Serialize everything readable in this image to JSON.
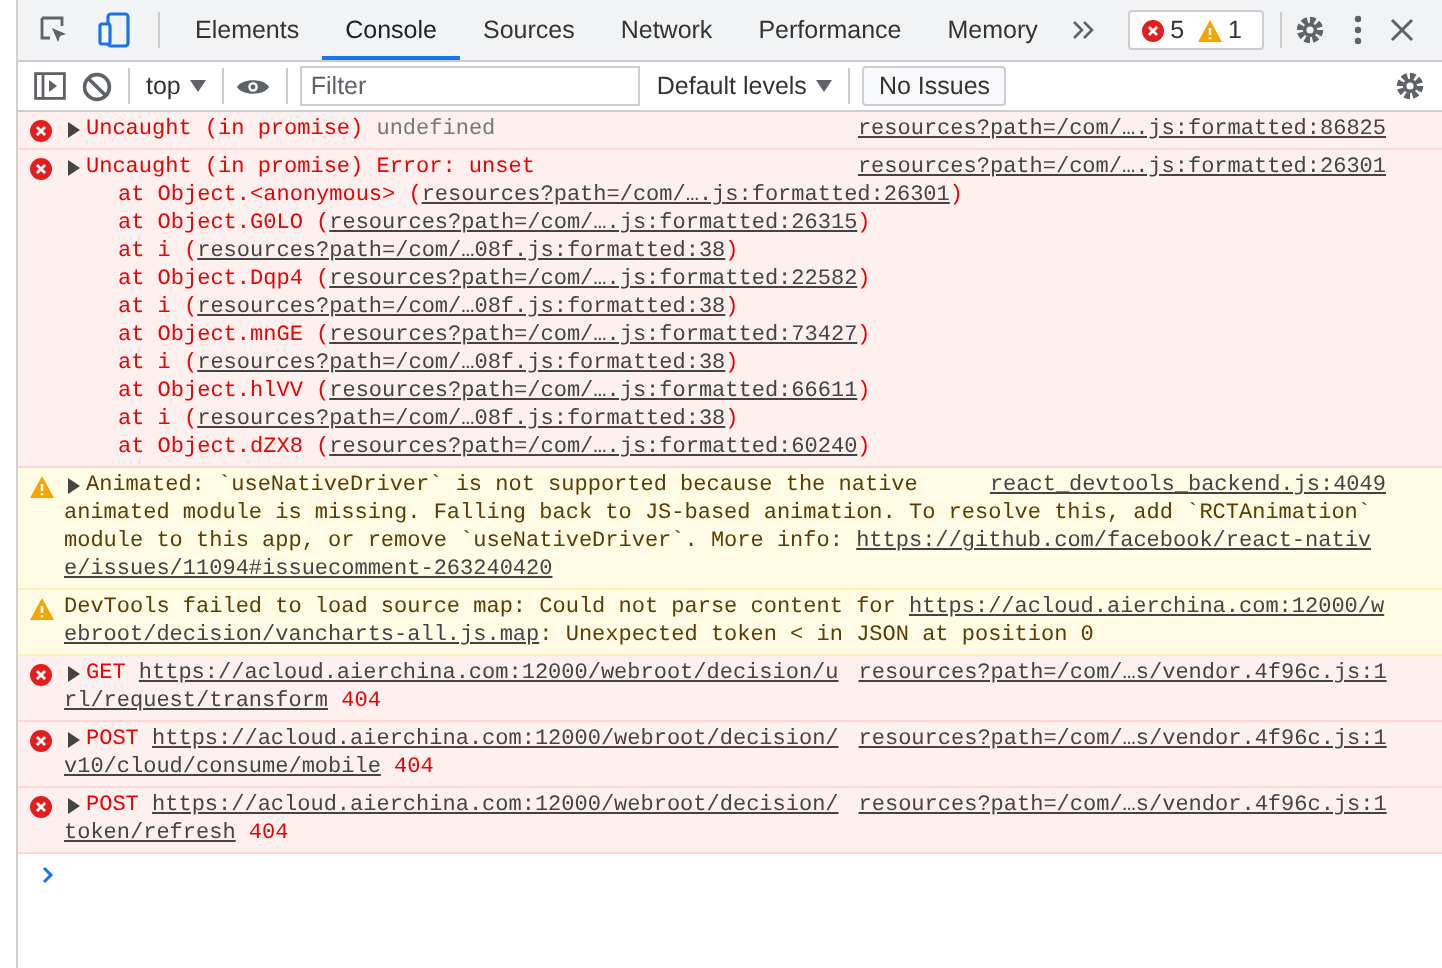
{
  "tabs": [
    {
      "label": "Elements",
      "selected": false
    },
    {
      "label": "Console",
      "selected": true
    },
    {
      "label": "Sources",
      "selected": false
    },
    {
      "label": "Network",
      "selected": false
    },
    {
      "label": "Performance",
      "selected": false
    },
    {
      "label": "Memory",
      "selected": false
    }
  ],
  "counts": {
    "errors": "5",
    "warnings": "1"
  },
  "toolbar": {
    "context": "top",
    "filter_placeholder": "Filter",
    "levels": "Default levels",
    "issues": "No Issues"
  },
  "messages": [
    {
      "kind": "error",
      "expandable": true,
      "source": "resources?path=/com/….js:formatted:86825",
      "lines": [
        [
          {
            "kind": "text",
            "text": "Uncaught (in promise) "
          },
          {
            "kind": "muted",
            "text": "undefined"
          }
        ]
      ]
    },
    {
      "kind": "error",
      "expandable": true,
      "source": "resources?path=/com/….js:formatted:26301",
      "lines": [
        [
          {
            "kind": "text",
            "text": "Uncaught (in promise) Error: unset"
          }
        ]
      ],
      "stack": [
        [
          {
            "kind": "text",
            "text": "at Object.<anonymous> ("
          },
          {
            "kind": "link",
            "text": "resources?path=/com/….js:formatted:26301"
          },
          {
            "kind": "text",
            "text": ")"
          }
        ],
        [
          {
            "kind": "text",
            "text": "at Object.G0LO ("
          },
          {
            "kind": "link",
            "text": "resources?path=/com/….js:formatted:26315"
          },
          {
            "kind": "text",
            "text": ")"
          }
        ],
        [
          {
            "kind": "text",
            "text": "at i ("
          },
          {
            "kind": "link",
            "text": "resources?path=/com/…08f.js:formatted:38"
          },
          {
            "kind": "text",
            "text": ")"
          }
        ],
        [
          {
            "kind": "text",
            "text": "at Object.Dqp4 ("
          },
          {
            "kind": "link",
            "text": "resources?path=/com/….js:formatted:22582"
          },
          {
            "kind": "text",
            "text": ")"
          }
        ],
        [
          {
            "kind": "text",
            "text": "at i ("
          },
          {
            "kind": "link",
            "text": "resources?path=/com/…08f.js:formatted:38"
          },
          {
            "kind": "text",
            "text": ")"
          }
        ],
        [
          {
            "kind": "text",
            "text": "at Object.mnGE ("
          },
          {
            "kind": "link",
            "text": "resources?path=/com/….js:formatted:73427"
          },
          {
            "kind": "text",
            "text": ")"
          }
        ],
        [
          {
            "kind": "text",
            "text": "at i ("
          },
          {
            "kind": "link",
            "text": "resources?path=/com/…08f.js:formatted:38"
          },
          {
            "kind": "text",
            "text": ")"
          }
        ],
        [
          {
            "kind": "text",
            "text": "at Object.hlVV ("
          },
          {
            "kind": "link",
            "text": "resources?path=/com/….js:formatted:66611"
          },
          {
            "kind": "text",
            "text": ")"
          }
        ],
        [
          {
            "kind": "text",
            "text": "at i ("
          },
          {
            "kind": "link",
            "text": "resources?path=/com/…08f.js:formatted:38"
          },
          {
            "kind": "text",
            "text": ")"
          }
        ],
        [
          {
            "kind": "text",
            "text": "at Object.dZX8 ("
          },
          {
            "kind": "link",
            "text": "resources?path=/com/….js:formatted:60240"
          },
          {
            "kind": "text",
            "text": ")"
          }
        ]
      ]
    },
    {
      "kind": "warning",
      "expandable": true,
      "source": "react_devtools_backend.js:4049",
      "lines": [
        [
          {
            "kind": "text",
            "text": "Animated: `useNativeDriver` is not supported because the native"
          }
        ],
        [
          {
            "kind": "text",
            "text": "animated module is missing. Falling back to JS-based animation. To resolve this, add `RCTAnimation`"
          }
        ],
        [
          {
            "kind": "text",
            "text": "module to this app, or remove `useNativeDriver`. More info: "
          },
          {
            "kind": "link",
            "text": "https://github.com/facebook/react-nativ"
          }
        ],
        [
          {
            "kind": "link",
            "text": "e/issues/11094#issuecomment-263240420"
          }
        ]
      ]
    },
    {
      "kind": "warning",
      "expandable": false,
      "lines": [
        [
          {
            "kind": "text",
            "text": "DevTools failed to load source map: Could not parse content for "
          },
          {
            "kind": "link",
            "text": "https://acloud.aierchina.com:12000/w"
          }
        ],
        [
          {
            "kind": "link",
            "text": "ebroot/decision/vancharts-all.js.map"
          },
          {
            "kind": "text",
            "text": ": Unexpected token < in JSON at position 0"
          }
        ]
      ]
    },
    {
      "kind": "error",
      "expandable": true,
      "source": "resources?path=/com/…s/vendor.4f96c.js:1",
      "lines": [
        [
          {
            "kind": "text",
            "text": "GET "
          },
          {
            "kind": "link",
            "text": "https://acloud.aierchina.com:12000/webroot/decision/u"
          }
        ],
        [
          {
            "kind": "link",
            "text": "rl/request/transform"
          },
          {
            "kind": "text",
            "text": " 404"
          }
        ]
      ]
    },
    {
      "kind": "error",
      "expandable": true,
      "source": "resources?path=/com/…s/vendor.4f96c.js:1",
      "lines": [
        [
          {
            "kind": "text",
            "text": "POST "
          },
          {
            "kind": "link",
            "text": "https://acloud.aierchina.com:12000/webroot/decision/"
          }
        ],
        [
          {
            "kind": "link",
            "text": "v10/cloud/consume/mobile"
          },
          {
            "kind": "text",
            "text": " 404"
          }
        ]
      ]
    },
    {
      "kind": "error",
      "expandable": true,
      "source": "resources?path=/com/…s/vendor.4f96c.js:1",
      "lines": [
        [
          {
            "kind": "text",
            "text": "POST "
          },
          {
            "kind": "link",
            "text": "https://acloud.aierchina.com:12000/webroot/decision/"
          }
        ],
        [
          {
            "kind": "link",
            "text": "token/refresh"
          },
          {
            "kind": "text",
            "text": " 404"
          }
        ]
      ]
    }
  ]
}
